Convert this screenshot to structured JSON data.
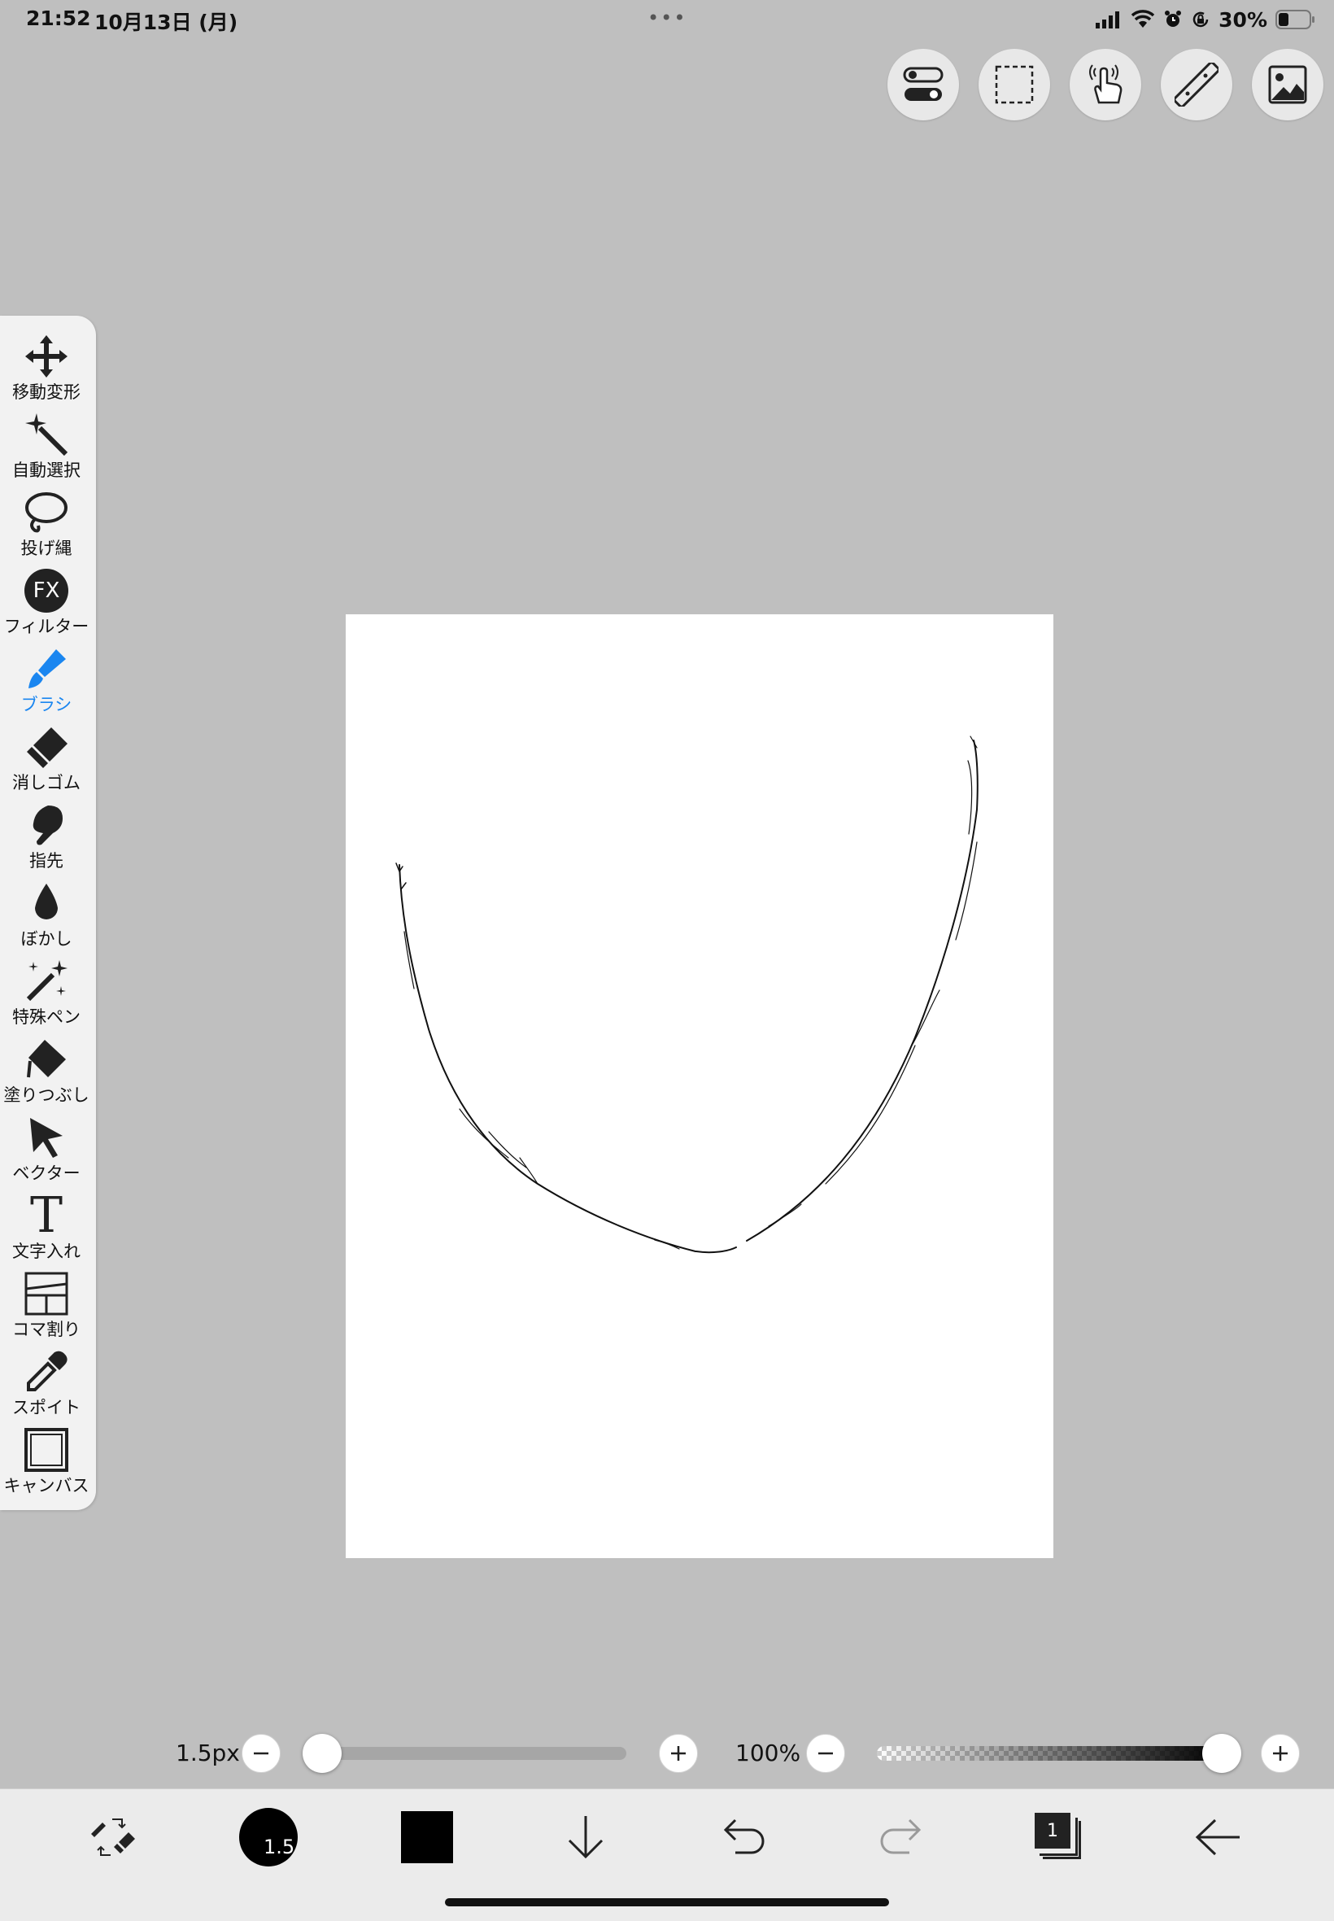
{
  "status_bar": {
    "time": "21:52",
    "date": "10月13日 (月)",
    "multitask_dots": "•••",
    "battery_percent": "30%",
    "icons": [
      "cellular-signal-icon",
      "wifi-icon",
      "alarm-icon",
      "orientation-lock-icon",
      "battery-icon"
    ]
  },
  "top_toolbar": {
    "buttons": [
      "toggle-settings-icon",
      "selection-icon",
      "touch-gesture-icon",
      "ruler-icon",
      "material-image-icon"
    ]
  },
  "tools": [
    {
      "label": "移動変形",
      "icon": "move-transform-icon"
    },
    {
      "label": "自動選択",
      "icon": "magic-wand-icon"
    },
    {
      "label": "投げ縄",
      "icon": "lasso-icon"
    },
    {
      "label": "フィルター",
      "icon": "filter-fx-icon",
      "glyph": "FX"
    },
    {
      "label": "ブラシ",
      "icon": "brush-icon",
      "active": true
    },
    {
      "label": "消しゴム",
      "icon": "eraser-icon"
    },
    {
      "label": "指先",
      "icon": "finger-smudge-icon"
    },
    {
      "label": "ぼかし",
      "icon": "blur-drop-icon"
    },
    {
      "label": "特殊ペン",
      "icon": "special-pen-icon"
    },
    {
      "label": "塗りつぶし",
      "icon": "fill-bucket-icon"
    },
    {
      "label": "ベクター",
      "icon": "vector-arrow-icon"
    },
    {
      "label": "文字入れ",
      "icon": "text-icon",
      "glyph": "T"
    },
    {
      "label": "コマ割り",
      "icon": "panel-layout-icon"
    },
    {
      "label": "スポイト",
      "icon": "eyedropper-icon"
    },
    {
      "label": "キャンバス",
      "icon": "canvas-icon"
    }
  ],
  "brush_size": {
    "label": "1.5px",
    "value": 1.5,
    "level": 0.0
  },
  "opacity": {
    "label": "100%",
    "value": 100,
    "level": 1.0
  },
  "bottom_bar": {
    "brush_size_badge": "1.5",
    "current_color": "#000000",
    "layer_count": "1",
    "icons": [
      "swap-brush-eraser-icon",
      "brush-size-icon",
      "color-swatch-icon",
      "download-arrow-icon",
      "undo-icon",
      "redo-icon",
      "layers-icon",
      "back-arrow-icon"
    ]
  },
  "colors": {
    "background": "#bfbfbf",
    "accent": "#1a86f0",
    "canvas": "#ffffff"
  }
}
